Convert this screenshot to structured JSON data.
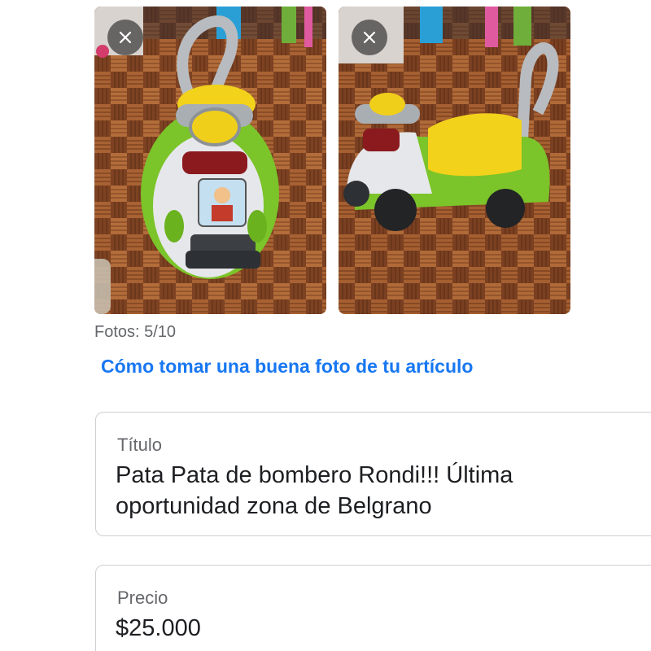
{
  "photos": [
    {
      "alt": "Pata Pata de bombero Rondi - vista frontal",
      "remove_icon": "close-icon"
    },
    {
      "alt": "Pata Pata de bombero Rondi - vista lateral",
      "remove_icon": "close-icon"
    }
  ],
  "photo_count": "Fotos: 5/10",
  "tips_link": "Cómo tomar una buena foto de tu artículo",
  "title_field": {
    "label": "Título",
    "value": "Pata Pata de bombero Rondi!!! Última oportunidad zona de Belgrano"
  },
  "price_field": {
    "label": "Precio",
    "value": "$25.000"
  },
  "colors": {
    "link": "#1877f2",
    "muted_text": "#65676b",
    "border": "#ced0d4",
    "toy_green": "#7bc42a",
    "toy_yellow": "#f2d21b"
  }
}
